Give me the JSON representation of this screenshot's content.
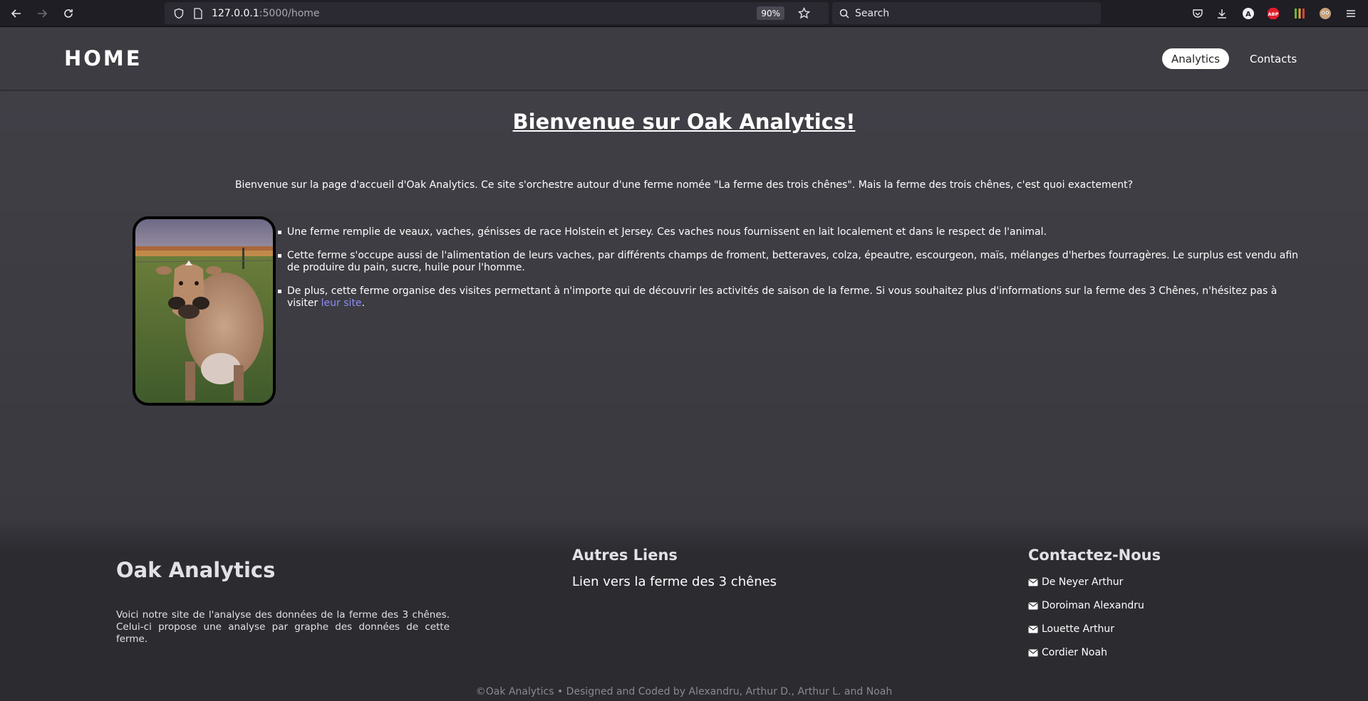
{
  "browser": {
    "url_host": "127.0.0.1",
    "url_path": ":5000/home",
    "zoom": "90%",
    "search_placeholder": "Search",
    "icons": [
      "back-icon",
      "forward-icon",
      "reload-icon",
      "shield-icon",
      "page-icon",
      "star-icon",
      "search-icon",
      "pocket-icon",
      "download-icon",
      "account-icon",
      "adblock-icon",
      "extension-icon",
      "profile-icon",
      "menu-icon"
    ],
    "account_letter": "A",
    "adblock_label": "ABP"
  },
  "header": {
    "brand": "HOME",
    "nav": [
      {
        "label": "Analytics",
        "active": true
      },
      {
        "label": "Contacts",
        "active": false
      }
    ]
  },
  "main": {
    "title": "Bienvenue sur Oak Analytics!",
    "intro": "Bienvenue sur la page d'accueil d'Oak Analytics. Ce site s'orchestre autour d'une ferme nomée \"La ferme des trois chênes\". Mais la ferme des trois chênes, c'est quoi exactement?",
    "bullets": [
      "Une ferme remplie de veaux, vaches, génisses de race Holstein et Jersey. Ces vaches nous fournissent en lait localement et dans le respect de l'animal.",
      "Cette ferme s'occupe aussi de l'alimentation de leurs vaches, par différents champs de froment, betteraves, colza, épeautre, escourgeon, maïs, mélanges d'herbes fourragères. Le surplus est vendu afin de produire du pain, sucre, huile pour l'homme."
    ],
    "bullet3_text": "De plus, cette ferme organise des visites permettant à n'importe qui de découvrir les activités de saison de la ferme. Si vous souhaitez plus d'informations sur la ferme des 3 Chênes, n'hésitez pas à visiter ",
    "bullet3_link": "leur site",
    "bullet3_end": ".",
    "link_color": "#8b8cf5"
  },
  "footer": {
    "brand": "Oak Analytics",
    "description": "Voici notre site de l'analyse des données de la ferme des 3 chênes. Celui-ci propose une analyse par graphe des données de cette ferme.",
    "links_title": "Autres Liens",
    "link": "Lien vers la ferme des 3 chênes",
    "contact_title": "Contactez-Nous",
    "contacts": [
      "De Neyer Arthur",
      "Doroiman Alexandru",
      "Louette Arthur",
      "Cordier Noah"
    ],
    "copyright": "©Oak Analytics • Designed and Coded by Alexandru, Arthur D., Arthur L. and Noah"
  }
}
